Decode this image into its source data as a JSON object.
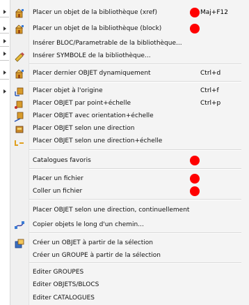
{
  "menu": {
    "items": [
      {
        "label": "Placer un objet de la bibliothèque (xref)",
        "shortcut": "Maj+F12",
        "icon": "library-object-icon",
        "marker": true
      },
      {
        "label": "Placer un objet de la bibliothèque (block)",
        "shortcut": "",
        "icon": "library-object-icon",
        "marker": true
      },
      {
        "label": "Insérer BLOC/Parametrable de la bibliothèque...",
        "shortcut": "",
        "icon": "",
        "marker": false
      },
      {
        "label": "Insérer SYMBOLE de la bibliothèque...",
        "shortcut": "",
        "icon": "symbol-icon",
        "marker": false
      },
      {
        "label": "Placer dernier OBJET dynamiquement",
        "shortcut": "Ctrl+d",
        "icon": "library-object-icon",
        "marker": false
      },
      {
        "label": "Placer objet à l'origine",
        "shortcut": "Ctrl+f",
        "icon": "place-origin-icon",
        "marker": false
      },
      {
        "label": "Placer OBJET par point+échelle",
        "shortcut": "Ctrl+p",
        "icon": "place-point-icon",
        "marker": false
      },
      {
        "label": "Placer OBJET avec orientation+échelle",
        "shortcut": "",
        "icon": "place-orientation-icon",
        "marker": false
      },
      {
        "label": "Placer OBJET selon une direction",
        "shortcut": "",
        "icon": "place-direction-icon",
        "marker": false
      },
      {
        "label": "Placer OBJET selon une direction+échelle",
        "shortcut": "",
        "icon": "place-direction-scale-icon",
        "marker": false
      },
      {
        "label": "Catalogues favoris",
        "shortcut": "",
        "icon": "",
        "marker": true
      },
      {
        "label": "Placer un fichier",
        "shortcut": "",
        "icon": "",
        "marker": true
      },
      {
        "label": "Coller un fichier",
        "shortcut": "",
        "icon": "",
        "marker": true
      },
      {
        "label": "Placer OBJET selon une direction, continuellement",
        "shortcut": "",
        "icon": "",
        "marker": false
      },
      {
        "label": "Copier objets le long d'un chemin...",
        "shortcut": "",
        "icon": "copy-along-path-icon",
        "marker": false
      },
      {
        "label": "Créer un OBJET à partir de la sélection",
        "shortcut": "",
        "icon": "create-object-icon",
        "marker": false
      },
      {
        "label": "Créer un GROUPE à partir de la sélection",
        "shortcut": "",
        "icon": "",
        "marker": false
      },
      {
        "label": "Editer GROUPES",
        "shortcut": "",
        "icon": "",
        "marker": false
      },
      {
        "label": "Editer OBJETS/BLOCS",
        "shortcut": "",
        "icon": "",
        "marker": false
      },
      {
        "label": "Editer CATALOGUES",
        "shortcut": "",
        "icon": "",
        "marker": false
      }
    ]
  },
  "colors": {
    "marker": "#ff0000",
    "menu_bg": "#f4f4f4"
  }
}
